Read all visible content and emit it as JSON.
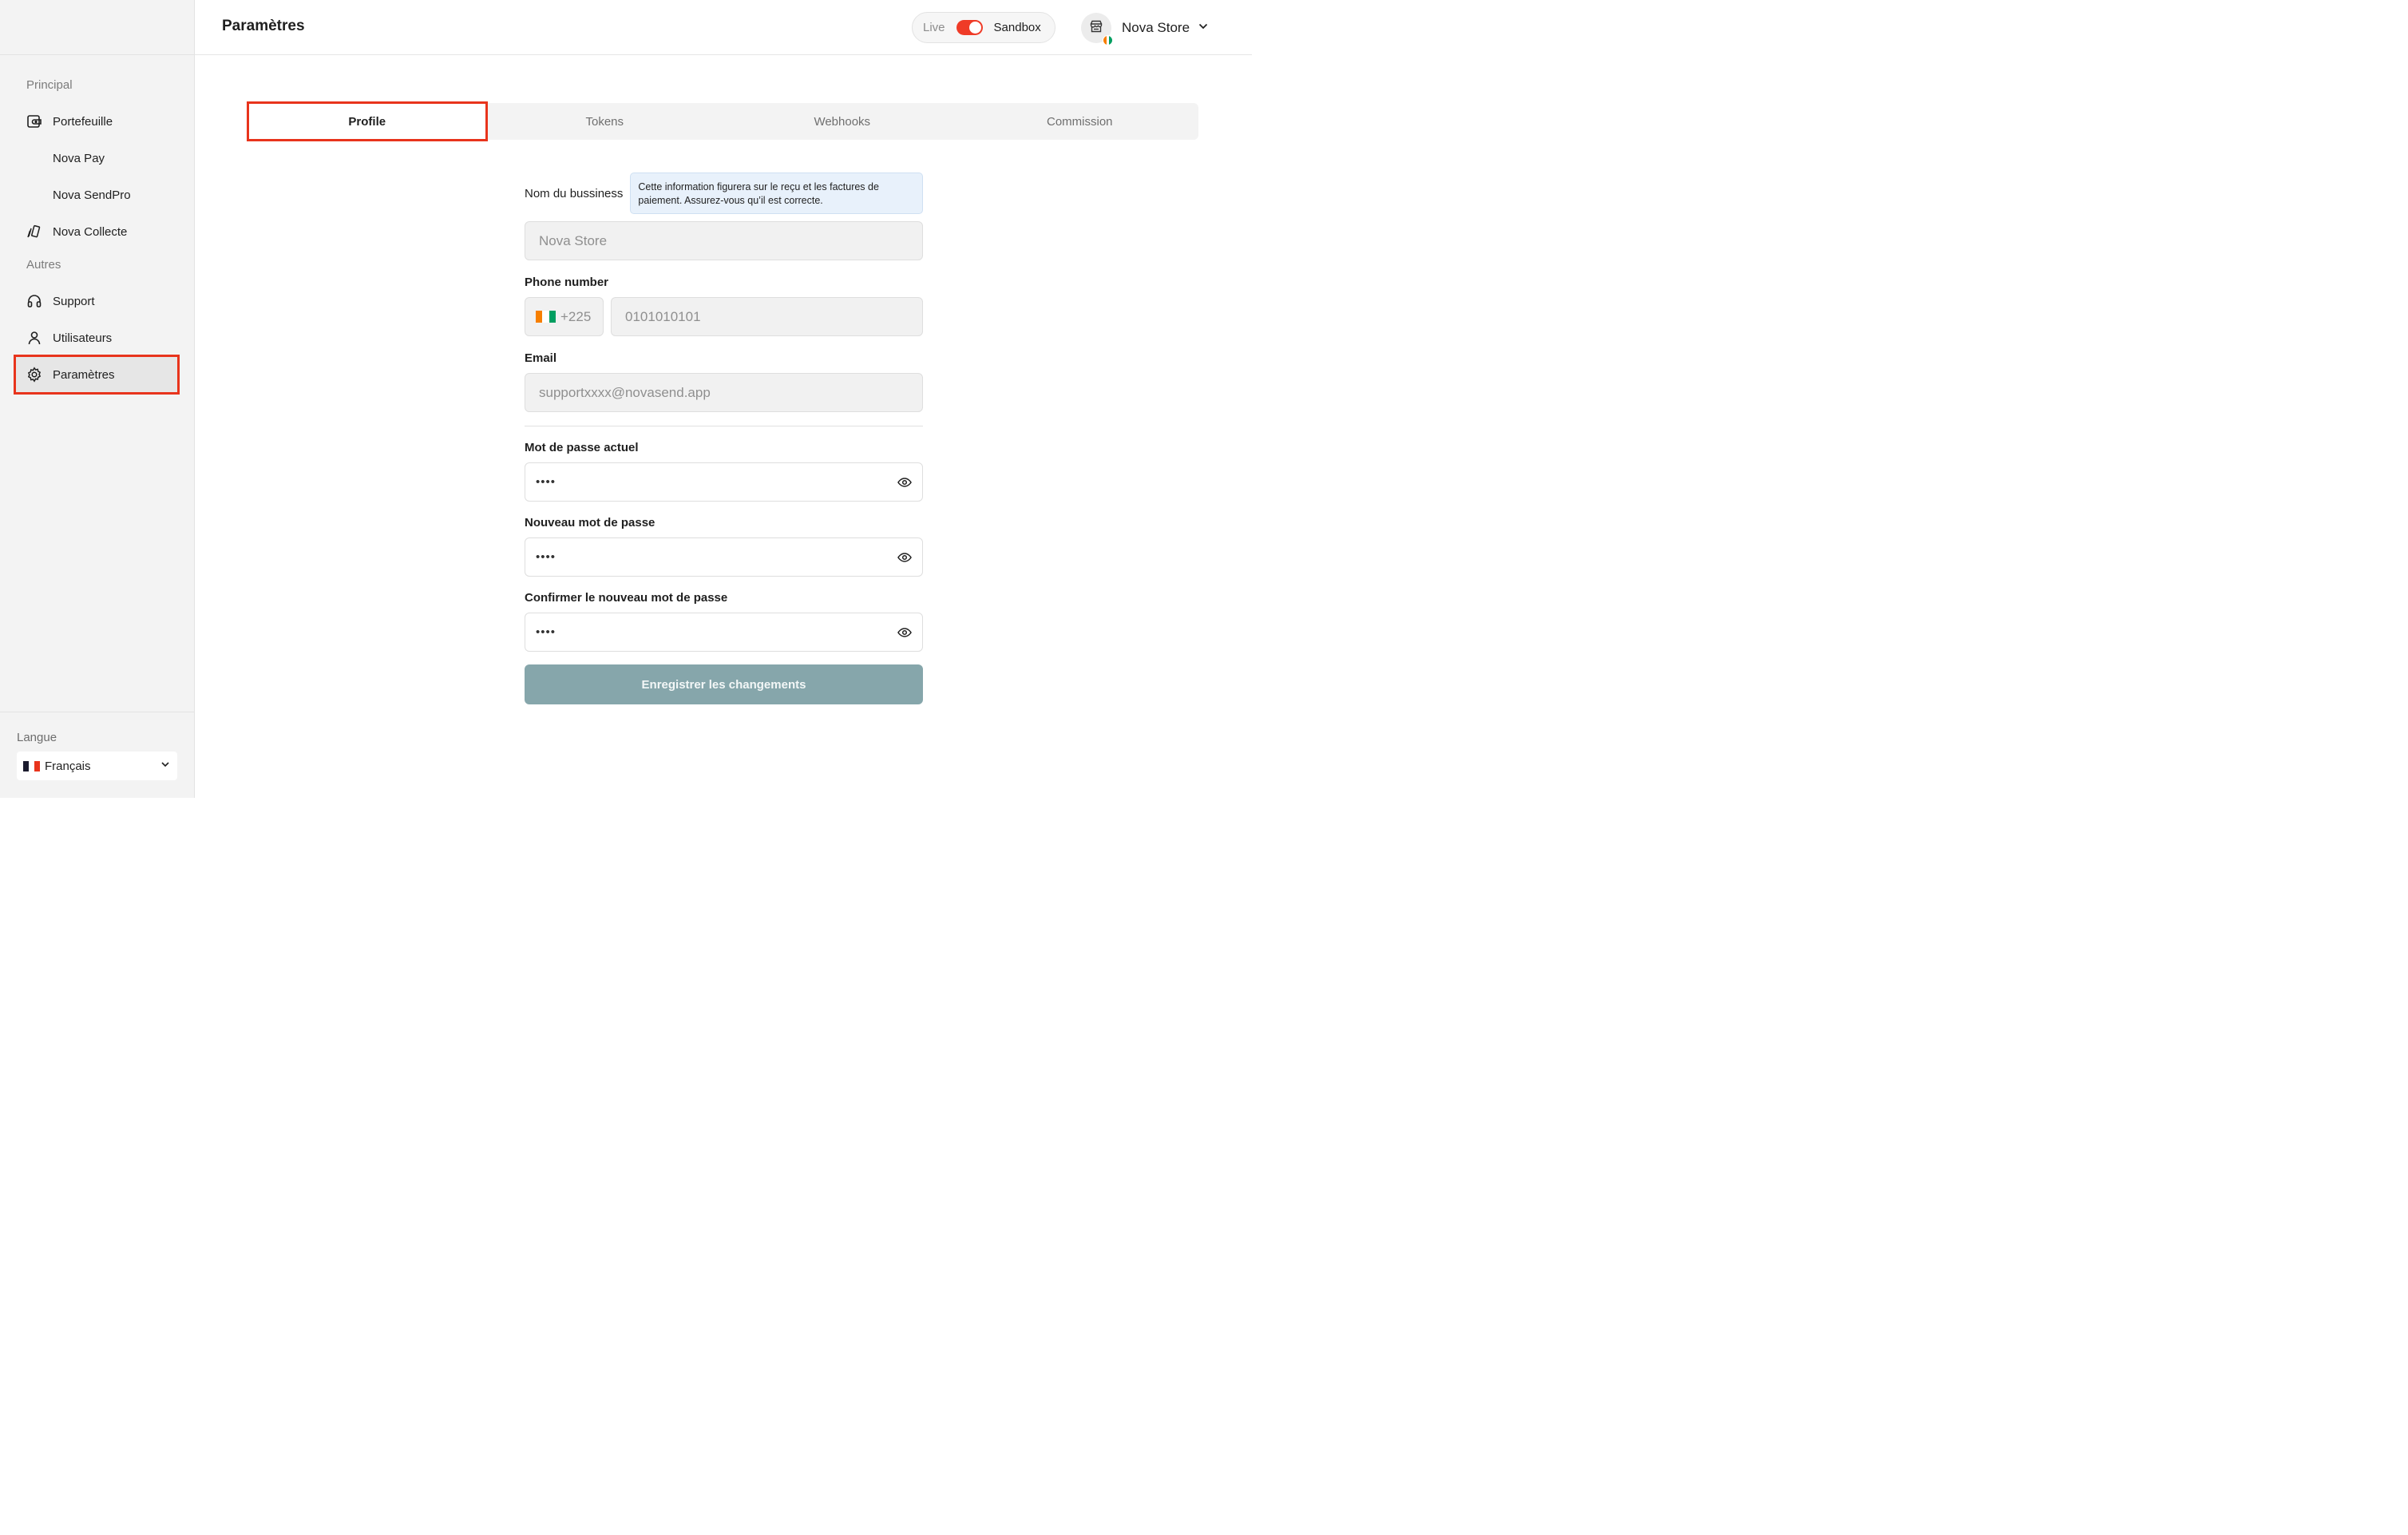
{
  "sidebar": {
    "section_principal": "Principal",
    "section_autres": "Autres",
    "items": [
      {
        "label": "Portefeuille"
      },
      {
        "label": "Nova Pay"
      },
      {
        "label": "Nova SendPro"
      },
      {
        "label": "Nova Collecte"
      },
      {
        "label": "Support"
      },
      {
        "label": "Utilisateurs"
      },
      {
        "label": "Paramètres"
      }
    ],
    "language_label": "Langue",
    "language_value": "Français"
  },
  "header": {
    "title": "Paramètres",
    "env_live": "Live",
    "env_sandbox": "Sandbox",
    "store_name": "Nova Store"
  },
  "tabs": [
    {
      "label": "Profile"
    },
    {
      "label": "Tokens"
    },
    {
      "label": "Webhooks"
    },
    {
      "label": "Commission"
    }
  ],
  "form": {
    "business_label": "Nom du bussiness",
    "business_info": "Cette information figurera sur le reçu et les factures de paiement. Assurez-vous qu’il est correcte.",
    "business_value": "Nova Store",
    "phone_label": "Phone number",
    "phone_code": "+225",
    "phone_value": "0101010101",
    "email_label": "Email",
    "email_value": "supportxxxx@novasend.app",
    "current_password_label": "Mot de passe actuel",
    "current_password_value": "••••",
    "new_password_label": "Nouveau mot de passe",
    "new_password_value": "••••",
    "confirm_password_label": "Confirmer le nouveau mot de passe",
    "confirm_password_value": "••••",
    "save_label": "Enregistrer les changements"
  },
  "colors": {
    "accent_red": "#e8341c",
    "toggle_red": "#ef3b27",
    "save_button": "#86a6ab",
    "info_box": "#e8f1fb"
  }
}
